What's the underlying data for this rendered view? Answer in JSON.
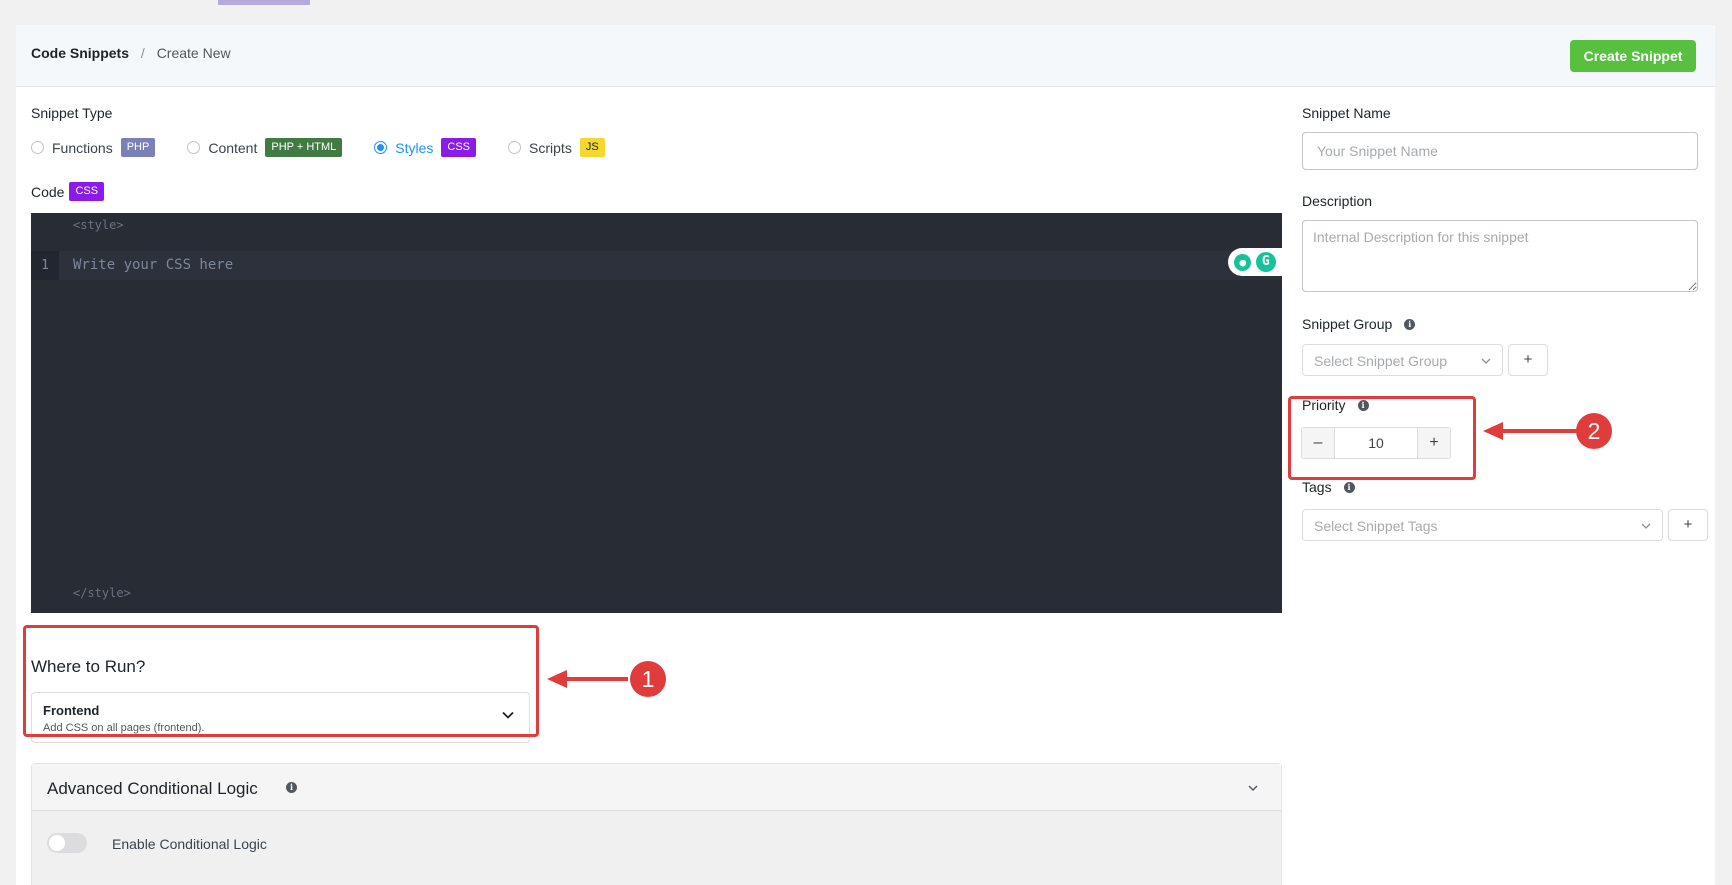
{
  "header": {
    "breadcrumb_root": "Code Snippets",
    "breadcrumb_sep": "/",
    "breadcrumb_current": "Create New",
    "create_button": "Create Snippet"
  },
  "snippet_type": {
    "label": "Snippet Type",
    "options": [
      {
        "label": "Functions",
        "badge": "PHP",
        "badge_color": "#7b80b7",
        "selected": false
      },
      {
        "label": "Content",
        "badge": "PHP + HTML",
        "badge_color": "#417b43",
        "selected": false
      },
      {
        "label": "Styles",
        "badge": "CSS",
        "badge_color": "#8a1be8",
        "selected": true
      },
      {
        "label": "Scripts",
        "badge": "JS",
        "badge_color": "#f4d82e",
        "selected": false
      }
    ]
  },
  "code": {
    "label": "Code",
    "badge": "CSS",
    "open_tag": "<style>",
    "close_tag": "</style>",
    "line_number": "1",
    "placeholder": "Write your CSS here"
  },
  "where_to_run": {
    "title": "Where to Run?",
    "selected_title": "Frontend",
    "selected_desc": "Add CSS on all pages (frontend)."
  },
  "advanced": {
    "title": "Advanced Conditional Logic",
    "toggle_label": "Enable Conditional Logic",
    "toggle_on": false
  },
  "sidebar": {
    "name_label": "Snippet Name",
    "name_placeholder": "Your Snippet Name",
    "description_label": "Description",
    "description_placeholder": "Internal Description for this snippet",
    "group_label": "Snippet Group",
    "group_placeholder": "Select Snippet Group",
    "group_add": "+",
    "priority_label": "Priority",
    "priority_value": "10",
    "priority_minus": "–",
    "priority_plus": "+",
    "tags_label": "Tags",
    "tags_placeholder": "Select Snippet Tags",
    "tags_add": "+"
  },
  "annotations": {
    "callout_1": "1",
    "callout_2": "2",
    "color": "#e03c3c"
  },
  "accent": {
    "primary_button": "#58c03f",
    "radio_selected": "#1e90ff"
  }
}
